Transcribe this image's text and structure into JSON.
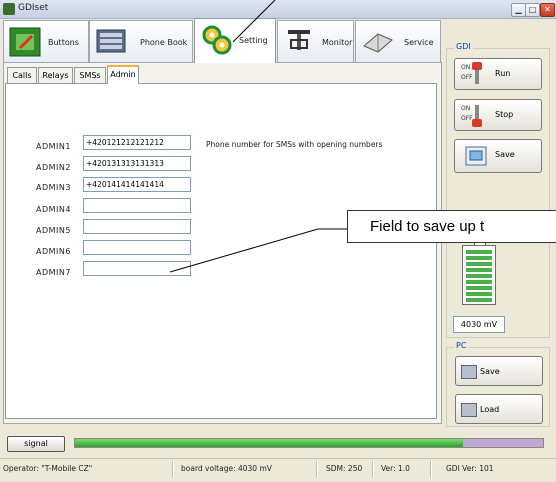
{
  "window": {
    "title": "GDIset",
    "min_glyph": "▁",
    "max_glyph": "□",
    "close_glyph": "✕"
  },
  "top_tabs": [
    {
      "label": "Buttons"
    },
    {
      "label": "Phone Book"
    },
    {
      "label": "Setting",
      "active": true
    },
    {
      "label": "Monitor"
    },
    {
      "label": "Service"
    }
  ],
  "sub_tabs": [
    {
      "label": "Calls"
    },
    {
      "label": "Relays"
    },
    {
      "label": "SMSs"
    },
    {
      "label": "Admin",
      "active": true
    }
  ],
  "admin": {
    "rows": [
      {
        "label": "ADMIN1",
        "value": "+420121212121212"
      },
      {
        "label": "ADMIN2",
        "value": "+420131313131313"
      },
      {
        "label": "ADMIN3",
        "value": "+420141414141414"
      },
      {
        "label": "ADMIN4",
        "value": ""
      },
      {
        "label": "ADMIN5",
        "value": ""
      },
      {
        "label": "ADMIN6",
        "value": ""
      },
      {
        "label": "ADMIN7",
        "value": ""
      }
    ],
    "hint": "Phone number for SMSs with opening numbers"
  },
  "callout": {
    "text": "Field to save up t"
  },
  "gdi_group": {
    "title": "GDI",
    "run": {
      "label": "Run",
      "on": "ON",
      "off": "OFF"
    },
    "stop": {
      "label": "Stop",
      "on": "ON",
      "off": "OFF"
    },
    "save_label": "Save",
    "voltage": "4030 mV",
    "battery_level": 1.0
  },
  "pc_group": {
    "title": "PC",
    "save_label": "Save",
    "load_label": "Load"
  },
  "signal": {
    "label": "signal",
    "level": 0.83,
    "colors": {
      "fill": "#2da12a",
      "tail": "#c1a8d3"
    }
  },
  "status": {
    "operator": "Operator: \"T-Mobile CZ\"",
    "voltage": "board voltage: 4030 mV",
    "sdm": "SDM: 250",
    "ver": "Ver: 1.0",
    "gdi_ver": "GDI Ver: 101"
  }
}
